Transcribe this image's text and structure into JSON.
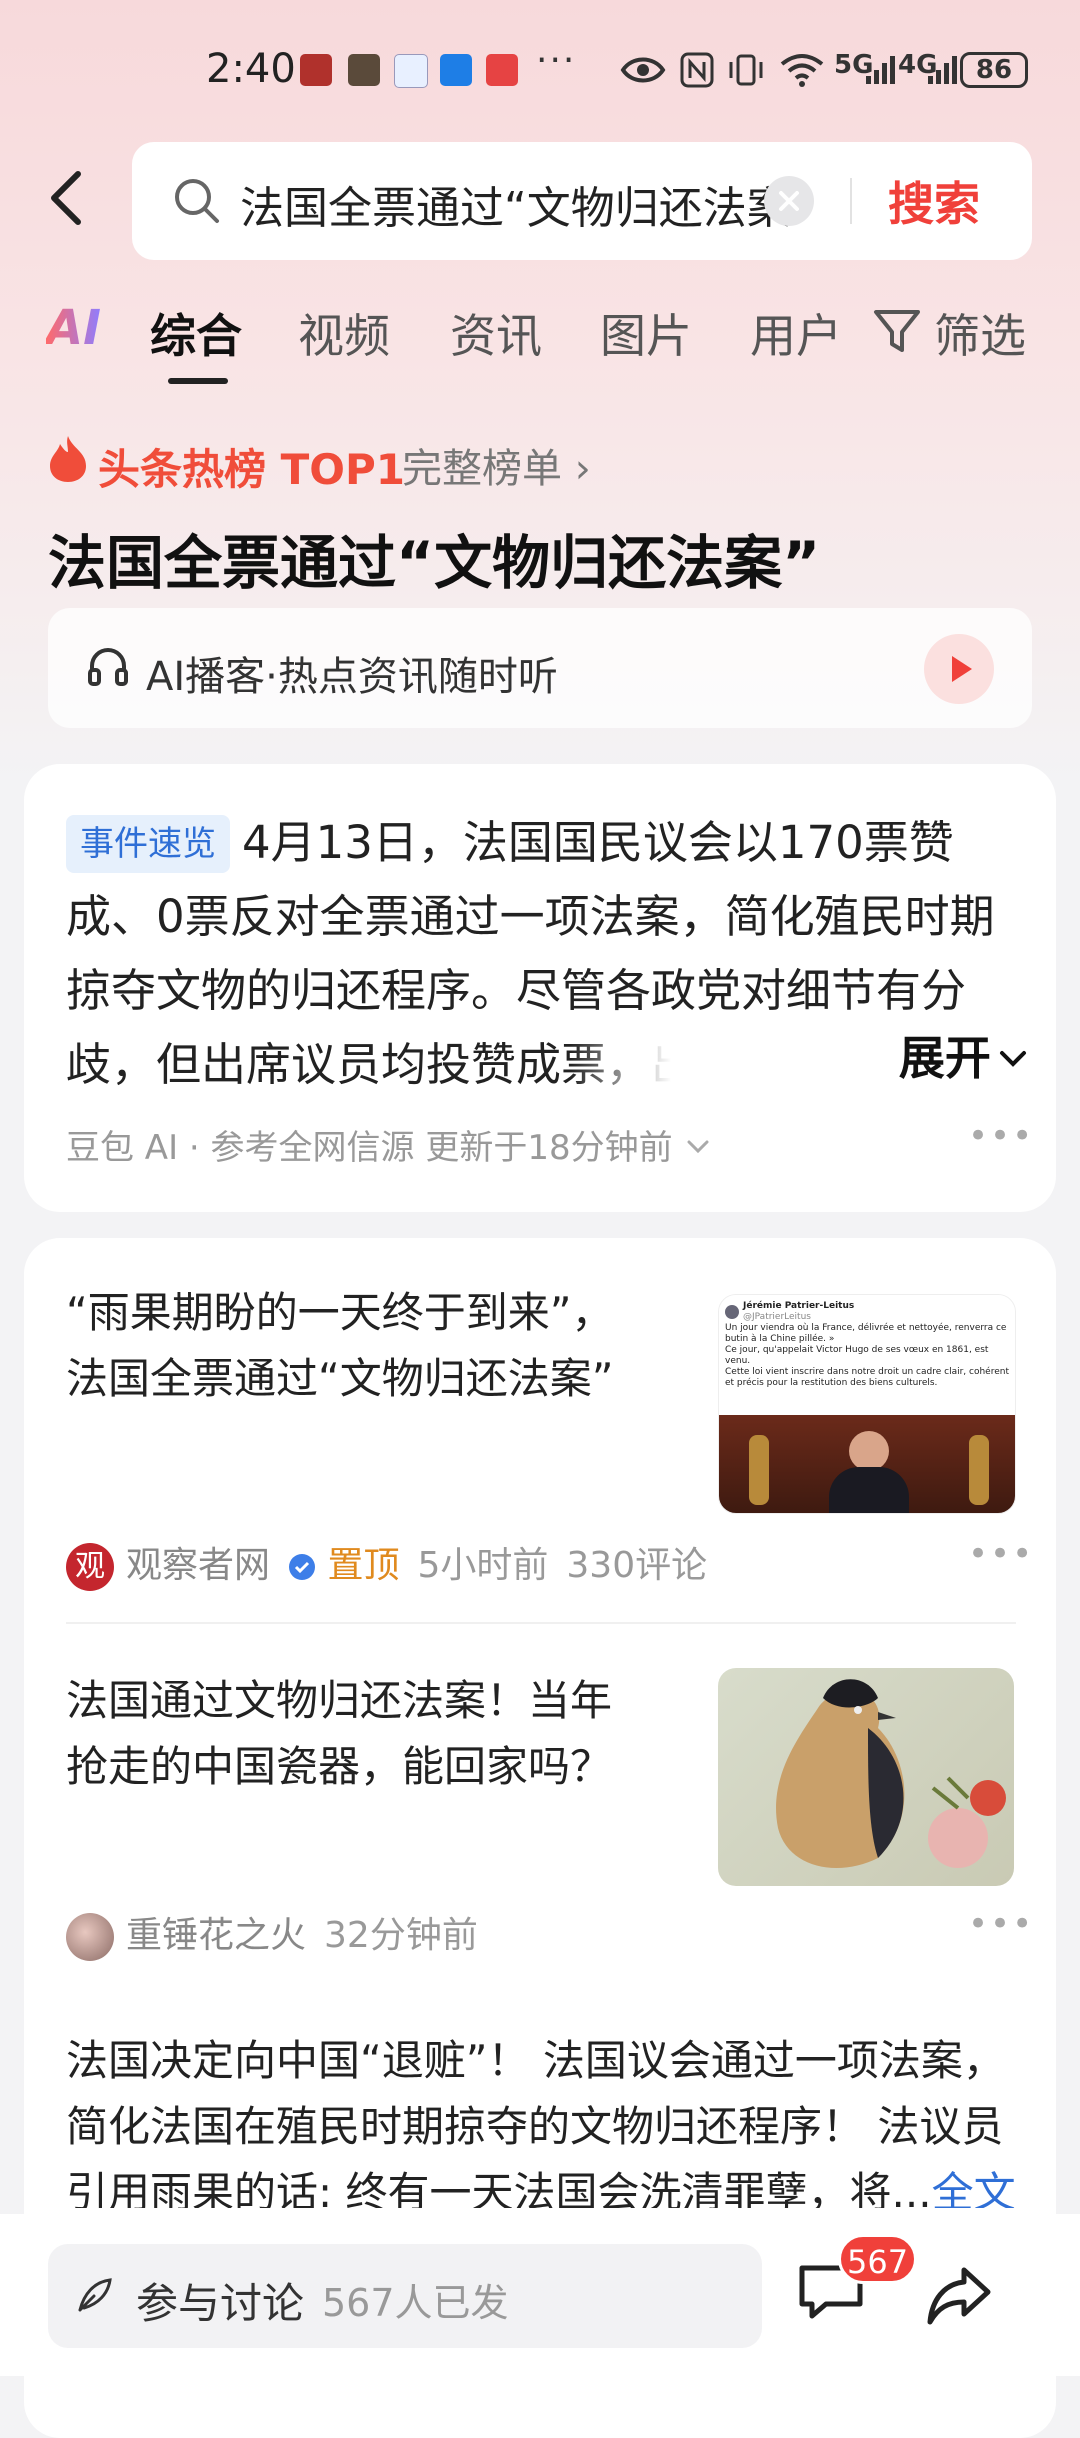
{
  "status_bar": {
    "time": "2:40",
    "more": "···",
    "network1": "5G",
    "network2": "4G",
    "battery": "86"
  },
  "search": {
    "query": "法国全票通过“文物归还法案”",
    "submit_label": "搜索"
  },
  "tabs": [
    {
      "label": "AI"
    },
    {
      "label": "综合"
    },
    {
      "label": "视频"
    },
    {
      "label": "资讯"
    },
    {
      "label": "图片"
    },
    {
      "label": "用户"
    },
    {
      "label": "筛选"
    }
  ],
  "hot": {
    "label": "头条热榜 TOP1",
    "full_list": "完整榜单 ›",
    "title": "法国全票通过“文物归还法案”"
  },
  "podcast": {
    "text": "AI播客·热点资讯随时听"
  },
  "summary": {
    "badge": "事件速览",
    "text": "4月13日，法国国民议会以170票赞成、0票反对全票通过一项法案，简化殖民时期掠夺文物的归还程序。尽管各政党对细节有分歧，但出席议员均投赞成票，出",
    "expand_label": "展开",
    "footer": "豆包 AI · 参考全网信源 更新于18分钟前"
  },
  "news": [
    {
      "title": "“雨果期盼的一天终于到来”，法国全票通过“文物归还法案”",
      "source": "观察者网",
      "pinned": "置顶",
      "time": "5小时前",
      "comments": "330评论",
      "thumb_text": [
        "Jérémie Patrier-Leitus",
        "@JPatrierLeitus",
        "Un jour viendra où la France, délivrée et nettoyée, renverra ce butin à la Chine pillée. »",
        "Ce jour, qu'appelait Victor Hugo de ses vœux en 1861, est venu.",
        "Cette loi vient inscrire dans notre droit un cadre clair, cohérent et précis pour la restitution des biens culturels."
      ]
    },
    {
      "title": "法国通过文物归还法案！当年抢走的中国瓷器，能回家吗？",
      "source": "重锤花之火",
      "time": "32分钟前"
    },
    {
      "text": "法国决定向中国“退赃”！ 法国议会通过一项法案，简化法国在殖民时期掠夺的文物归还程序！ 法议员引用雨果的话: 终有一天法国会洗清罪孽，将...",
      "full_label": "全文"
    }
  ],
  "bottom": {
    "discuss_label": "参与讨论",
    "discuss_count": "567人已发",
    "comment_badge": "567"
  },
  "colors": {
    "accent": "#f0403a",
    "link": "#2f6fd6",
    "pinned": "#e08a1e"
  }
}
